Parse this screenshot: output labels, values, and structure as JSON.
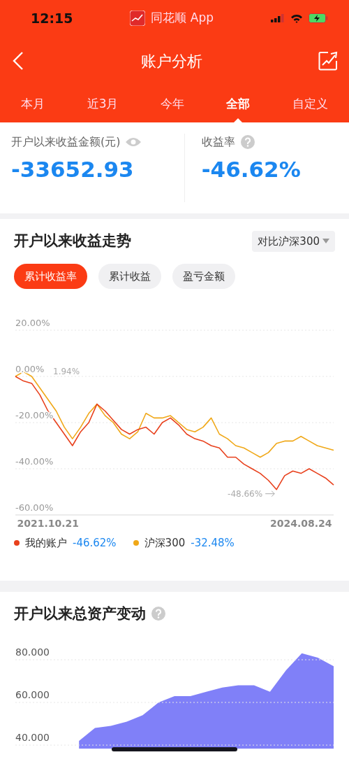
{
  "status_bar": {
    "time": "12:15",
    "app": "同花顺 App"
  },
  "header": {
    "title": "账户分析"
  },
  "tabs": [
    {
      "label": "本月",
      "selected": false
    },
    {
      "label": "近3月",
      "selected": false
    },
    {
      "label": "今年",
      "selected": false
    },
    {
      "label": "全部",
      "selected": true
    },
    {
      "label": "自定义",
      "selected": false
    }
  ],
  "summary": [
    {
      "label": "开户以来收益金额(元)",
      "value": "-33652.93",
      "kind": "eye"
    },
    {
      "label": "收益率",
      "value": "-46.62%",
      "kind": "help"
    }
  ],
  "trend": {
    "title": "开户以来收益走势",
    "compare": "对比沪深300",
    "chips": [
      {
        "label": "累计收益率",
        "selected": true
      },
      {
        "label": "累计收益",
        "selected": false
      },
      {
        "label": "盈亏金额",
        "selected": false
      }
    ],
    "chart_data": {
      "type": "line",
      "categories": [
        null,
        null,
        null,
        null,
        "2021.10.21",
        null,
        null,
        null,
        null,
        null,
        null,
        null,
        null,
        null,
        null,
        null,
        null,
        null,
        null,
        null,
        null,
        null,
        null,
        null,
        null,
        null,
        null,
        null,
        null,
        null,
        null,
        null,
        null,
        null,
        null,
        "2024.08.24",
        null,
        null,
        null,
        null
      ],
      "grid": true,
      "ylim": [
        -88.33,
        68.18
      ],
      "yticks": [
        {
          "value": 20,
          "label": "20.00%"
        },
        {
          "value": 0,
          "label": "0.00%"
        },
        {
          "value": -20,
          "label": "-20.00%"
        },
        {
          "value": -40,
          "label": "-40.00%"
        },
        {
          "value": -60,
          "label": "-60.00%"
        }
      ],
      "series": [
        {
          "name": "我的账户",
          "color": "#e8401c",
          "values": [
            0,
            -2,
            -3,
            -8,
            -15,
            -20,
            -25,
            -30,
            -24,
            -20,
            -12,
            -15,
            -19,
            -23,
            -25,
            -23,
            -22,
            -25,
            -20,
            -18,
            -21,
            -25,
            -27,
            -28,
            -30,
            -31,
            -35,
            -35,
            -38,
            -40,
            -42,
            -45,
            -49,
            -43,
            -41,
            -42,
            -40,
            -42,
            -44,
            -47
          ]
        },
        {
          "name": "沪深300",
          "color": "#f0a818",
          "values": [
            0,
            2,
            0,
            -5,
            -10,
            -15,
            -22,
            -27,
            -22,
            -16,
            -12,
            -17,
            -20,
            -25,
            -27,
            -24,
            -16,
            -18,
            -18,
            -17,
            -20,
            -23,
            -24,
            -22,
            -18,
            -25,
            -27,
            -30,
            -31,
            -33,
            -35,
            -33,
            -29,
            -28,
            -28,
            -26,
            -28,
            -30,
            -31,
            -32
          ]
        }
      ],
      "annotations": [
        "1.94%",
        "-48.66%"
      ]
    },
    "legend": [
      {
        "value": "-46.62%"
      },
      {
        "value": "-32.48%"
      }
    ]
  },
  "assets": {
    "title": "开户以来总资产变动",
    "chart_data": {
      "type": "area",
      "grid": true,
      "ylim": [
        34.23,
        111.8
      ],
      "categories": [
        null,
        null,
        null,
        null,
        null,
        null,
        null,
        null,
        null,
        null,
        null,
        null,
        null,
        null,
        null,
        null,
        null,
        null,
        null,
        null,
        null
      ],
      "yticks": [
        {
          "value": 80,
          "label": "80.000"
        },
        {
          "value": 60,
          "label": "60.000"
        },
        {
          "value": 40,
          "label": "40.000"
        }
      ],
      "series": [
        {
          "color": "#8080f8",
          "values": [
            null,
            null,
            null,
            null,
            42,
            48,
            49,
            51,
            54,
            60,
            63,
            63,
            65,
            67,
            68,
            68,
            65,
            75,
            83,
            81,
            77
          ]
        }
      ]
    }
  }
}
